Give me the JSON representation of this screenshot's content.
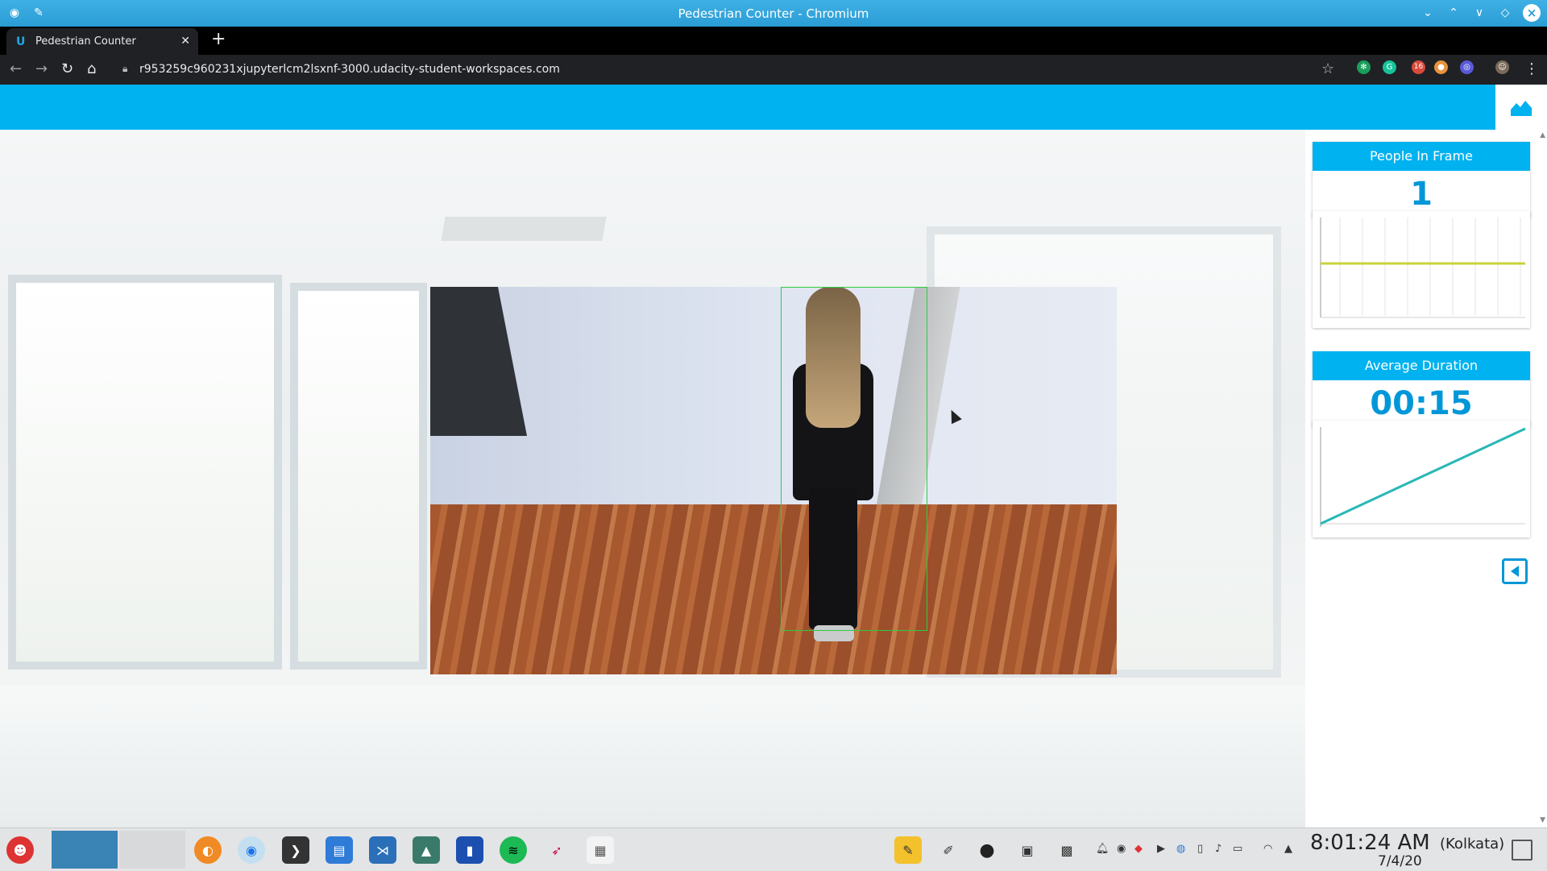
{
  "window": {
    "title": "Pedestrian Counter - Chromium"
  },
  "tabs": [
    {
      "label": "Pedestrian Counter"
    }
  ],
  "address_bar": {
    "url": "r953259c960231xjupyterlcm2lsxnf-3000.udacity-student-workspaces.com"
  },
  "extensions": {
    "badge_count": "16"
  },
  "panel": {
    "people_in_frame": {
      "label": "People In Frame",
      "value": "1"
    },
    "average_duration": {
      "label": "Average Duration",
      "value": "00:15"
    }
  },
  "taskbar": {
    "time": "8:01:24 AM",
    "timezone": "(Kolkata)",
    "date": "7/4/20"
  },
  "colors": {
    "accent": "#00b2ef",
    "value_text": "#0097d8",
    "people_line": "#c8d33a",
    "duration_line": "#2ab7b7",
    "detection_box": "#2ecc40"
  }
}
